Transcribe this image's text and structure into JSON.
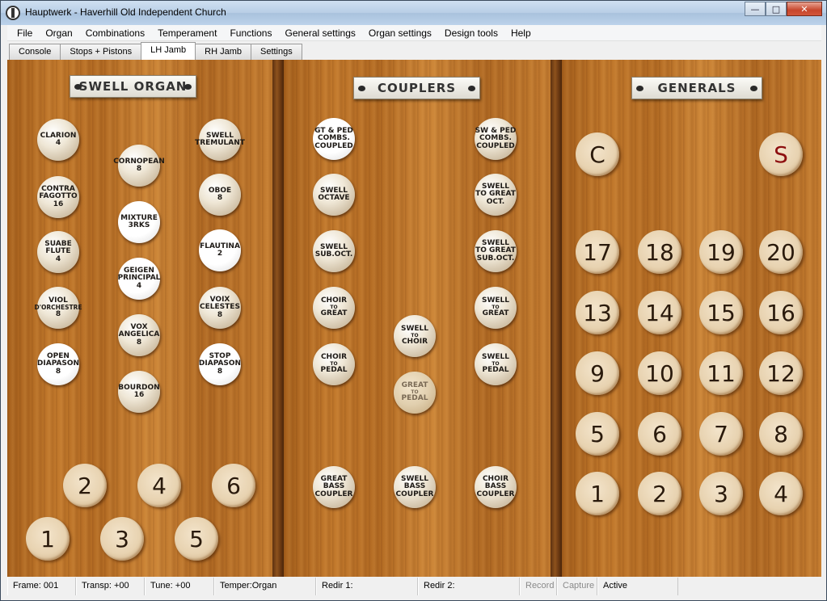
{
  "window": {
    "title": "Hauptwerk - Haverhill Old Independent Church"
  },
  "menu": [
    "File",
    "Organ",
    "Combinations",
    "Temperament",
    "Functions",
    "General settings",
    "Organ settings",
    "Design tools",
    "Help"
  ],
  "tabs": [
    {
      "label": "Console",
      "active": false
    },
    {
      "label": "Stops + Pistons",
      "active": false
    },
    {
      "label": "LH Jamb",
      "active": true
    },
    {
      "label": "RH Jamb",
      "active": false
    },
    {
      "label": "Settings",
      "active": false
    }
  ],
  "sections": {
    "swell": "SWELL ORGAN",
    "couplers": "COUPLERS",
    "generals": "GENERALS"
  },
  "swell_stops": [
    {
      "lines": [
        "CLARION",
        "4"
      ],
      "on": false
    },
    {
      "lines": [
        "CONTRA",
        "FAGOTTO",
        "16"
      ],
      "on": false
    },
    {
      "lines": [
        "SUABE",
        "FLUTE",
        "4"
      ],
      "on": false
    },
    {
      "lines": [
        "VIOL",
        "D'ORCHESTRE",
        "8"
      ],
      "on": false
    },
    {
      "lines": [
        "OPEN",
        "DIAPASON",
        "8"
      ],
      "on": true
    },
    {
      "lines": [
        "CORNOPEAN",
        "8"
      ],
      "on": false
    },
    {
      "lines": [
        "MIXTURE",
        "3RKS"
      ],
      "on": true
    },
    {
      "lines": [
        "GEIGEN",
        "PRINCIPAL",
        "4"
      ],
      "on": true
    },
    {
      "lines": [
        "VOX",
        "ANGELICA",
        "8"
      ],
      "on": false
    },
    {
      "lines": [
        "BOURDON",
        "16"
      ],
      "on": false
    },
    {
      "lines": [
        "SWELL",
        "TREMULANT"
      ],
      "on": false
    },
    {
      "lines": [
        "OBOE",
        "8"
      ],
      "on": false
    },
    {
      "lines": [
        "FLAUTINA",
        "2"
      ],
      "on": true
    },
    {
      "lines": [
        "VOIX",
        "CELESTES",
        "8"
      ],
      "on": false
    },
    {
      "lines": [
        "STOP",
        "DIAPASON",
        "8"
      ],
      "on": true
    }
  ],
  "swell_pistons": [
    "2",
    "4",
    "6",
    "1",
    "3",
    "5"
  ],
  "coupler_stops": [
    {
      "lines": [
        "GT & PED",
        "COMBS.",
        "COUPLED"
      ],
      "on": true
    },
    {
      "lines": [
        "SWELL",
        "OCTAVE"
      ],
      "on": false
    },
    {
      "lines": [
        "SWELL",
        "SUB.OCT."
      ],
      "on": false
    },
    {
      "lines": [
        "CHOIR",
        "TO",
        "GREAT"
      ],
      "on": false
    },
    {
      "lines": [
        "CHOIR",
        "TO",
        "PEDAL"
      ],
      "on": false
    },
    {
      "lines": [
        "SWELL",
        "TO",
        "CHOIR"
      ],
      "on": false
    },
    {
      "lines": [
        "GREAT",
        "TO",
        "PEDAL"
      ],
      "on": false,
      "dim": true
    },
    {
      "lines": [
        "SW & PED",
        "COMBS.",
        "COUPLED"
      ],
      "on": false
    },
    {
      "lines": [
        "SWELL",
        "TO GREAT",
        "OCT."
      ],
      "on": false
    },
    {
      "lines": [
        "SWELL",
        "TO GREAT",
        "SUB.OCT."
      ],
      "on": false
    },
    {
      "lines": [
        "SWELL",
        "TO",
        "GREAT"
      ],
      "on": false
    },
    {
      "lines": [
        "SWELL",
        "TO",
        "PEDAL"
      ],
      "on": false
    },
    {
      "lines": [
        "GREAT",
        "BASS",
        "COUPLER"
      ],
      "on": false
    },
    {
      "lines": [
        "SWELL",
        "BASS",
        "COUPLER"
      ],
      "on": false
    },
    {
      "lines": [
        "CHOIR",
        "BASS",
        "COUPLER"
      ],
      "on": false
    }
  ],
  "general_pistons": [
    "C",
    "S",
    "17",
    "18",
    "19",
    "20",
    "13",
    "14",
    "15",
    "16",
    "9",
    "10",
    "11",
    "12",
    "5",
    "6",
    "7",
    "8",
    "1",
    "2",
    "3",
    "4"
  ],
  "status": [
    "Frame: 001",
    "Transp: +00",
    "Tune: +00",
    "Temper:Organ",
    "Redir 1:",
    "Redir 2:",
    "Record",
    "Capture",
    "Active"
  ]
}
